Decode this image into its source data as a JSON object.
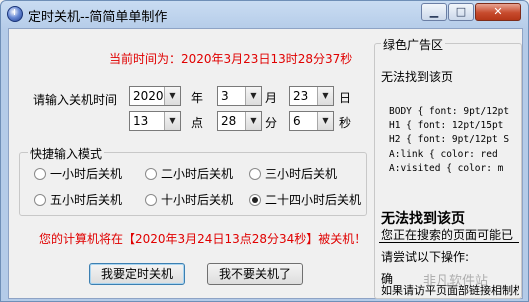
{
  "window": {
    "title": "定时关机--简简单单制作",
    "buttons": {
      "minimize": "▁",
      "maximize": "□",
      "close": "✕"
    }
  },
  "current_time_text": "当前时间为：2020年3月23日13时28分37秒",
  "input_label": "请输入关机时间",
  "date": {
    "year": "2020",
    "year_unit": "年",
    "month": "3",
    "month_unit": "月",
    "day": "23",
    "day_unit": "日"
  },
  "time": {
    "hour": "13",
    "hour_unit": "点",
    "minute": "28",
    "minute_unit": "分",
    "second": "6",
    "second_unit": "秒"
  },
  "quick_mode": {
    "title": "快捷输入模式",
    "options": [
      {
        "label": "一小时后关机",
        "selected": false
      },
      {
        "label": "二小时后关机",
        "selected": false
      },
      {
        "label": "三小时后关机",
        "selected": false
      },
      {
        "label": "五小时后关机",
        "selected": false
      },
      {
        "label": "十小时后关机",
        "selected": false
      },
      {
        "label": "二十四小时后关机",
        "selected": true
      }
    ]
  },
  "shutdown_message": "您的计算机将在【2020年3月24日13点28分34秒】被关机！",
  "actions": {
    "schedule": "我要定时关机",
    "cancel": "我不要关机了"
  },
  "ad": {
    "title": "绿色广告区",
    "not_found_small": "无法找到该页",
    "css_lines": [
      "BODY { font: 9pt/12pt",
      "H1 { font: 12pt/15pt",
      "H2 { font: 9pt/12pt S",
      "A:link { color: red",
      "A:visited { color: m"
    ],
    "not_found_big": "无法找到该页",
    "desc": "您正在搜索的页面可能已",
    "try_label": "请尝试以下操作:",
    "bottom_lines": [
      "确",
      "如果请访平页面部链接相制权"
    ],
    "watermark": "非凡软件站"
  },
  "colors": {
    "accent_red": "#e00000",
    "title_gradient_top": "#c9dcf2"
  }
}
